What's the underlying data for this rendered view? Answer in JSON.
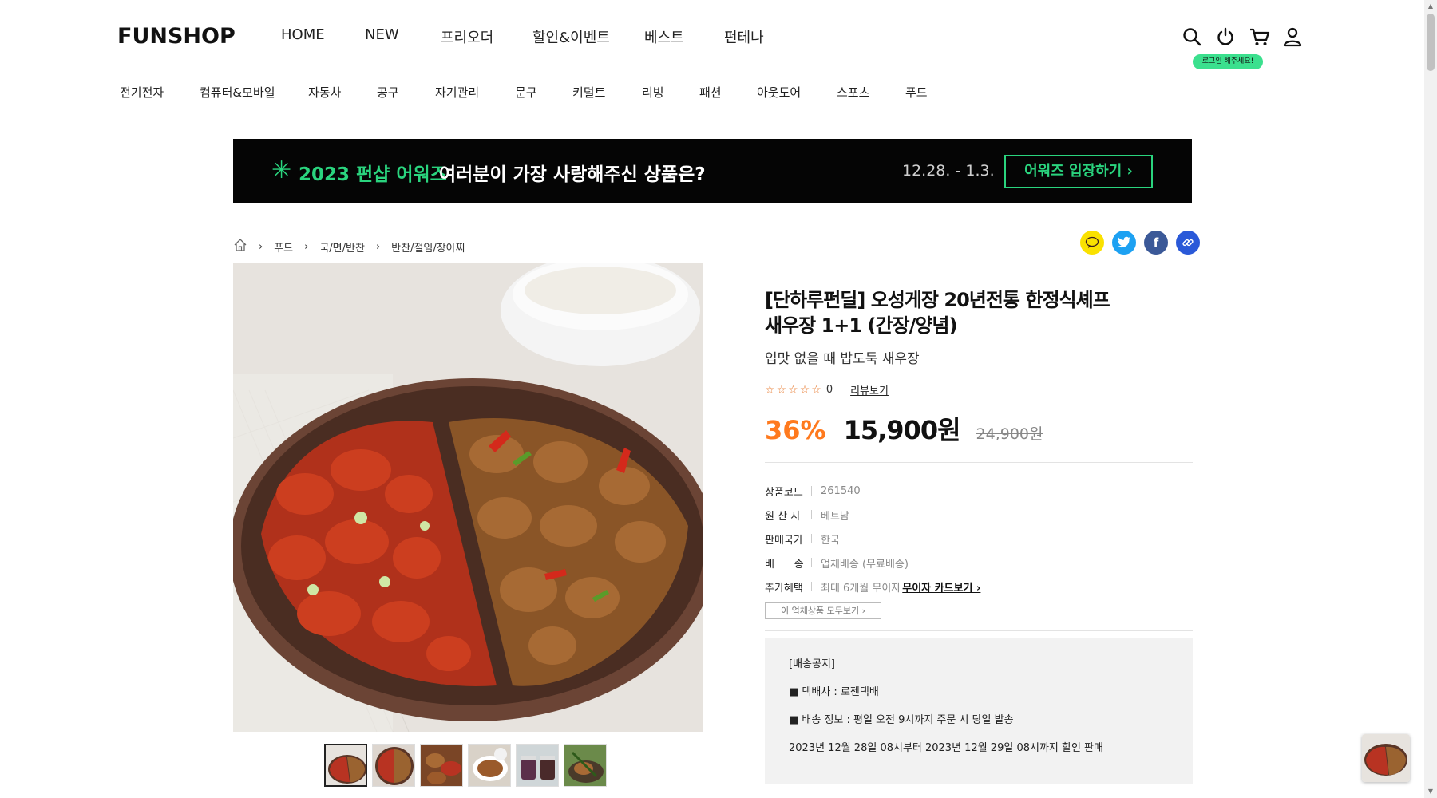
{
  "header": {
    "logo": "FUNSHOP",
    "nav": [
      "HOME",
      "NEW",
      "프리오더",
      "할인&이벤트",
      "베스트",
      "펀테나"
    ],
    "login_tip": "로그인 해주세요!",
    "icons": [
      "search-icon",
      "power-icon",
      "cart-icon",
      "user-icon"
    ]
  },
  "categories": [
    "전기전자",
    "컴퓨터&모바일",
    "자동차",
    "공구",
    "자기관리",
    "문구",
    "키덜트",
    "리빙",
    "패션",
    "아웃도어",
    "스포츠",
    "푸드"
  ],
  "banner": {
    "title": "2023 펀샵 어워즈",
    "subtitle": "여러분이 가장 사랑해주신 상품은?",
    "date": "12.28. - 1.3.",
    "button": "어워즈 입장하기 ›"
  },
  "breadcrumb": [
    "푸드",
    "국/면/반찬",
    "반찬/절임/장아찌"
  ],
  "share": [
    "talk-icon",
    "twitter-icon",
    "facebook-icon",
    "link-icon"
  ],
  "product": {
    "title_line1": "[단하루펀딜] 오성게장 20년전통 한정식셰프",
    "title_line2": "새우장 1+1 (간장/양념)",
    "desc": "입맛 없을 때 밥도둑 새우장",
    "rating_stars": 0,
    "review_count": "0",
    "review_link": "리뷰보기",
    "discount": "36%",
    "price": "15,900원",
    "original_price": "24,900원",
    "info": [
      {
        "k": "상품코드",
        "v": "261540"
      },
      {
        "k": "원 산 지",
        "v": "베트남"
      },
      {
        "k": "판매국가",
        "v": "한국"
      },
      {
        "k": "배      송",
        "v": "업체배송 (무료배송)"
      },
      {
        "k": "추가혜택",
        "v": "최대 6개월 무이자",
        "link": "무이자 카드보기 ›"
      }
    ],
    "seller_button": "이 업체상품 모두보기 ›"
  },
  "notice": {
    "title": "[배송공지]",
    "line1": "■ 택배사 : 로젠택배",
    "line2": "■ 배송 정보 : 평일 오전 9시까지 주문 시 당일 발송",
    "line3": "2023년 12월 28일 08시부터 2023년 12월 29일 08시까지 할인 판매"
  },
  "colors": {
    "accent": "#ff7a1e",
    "green": "#2ad47e",
    "banner_bg": "#050505"
  }
}
